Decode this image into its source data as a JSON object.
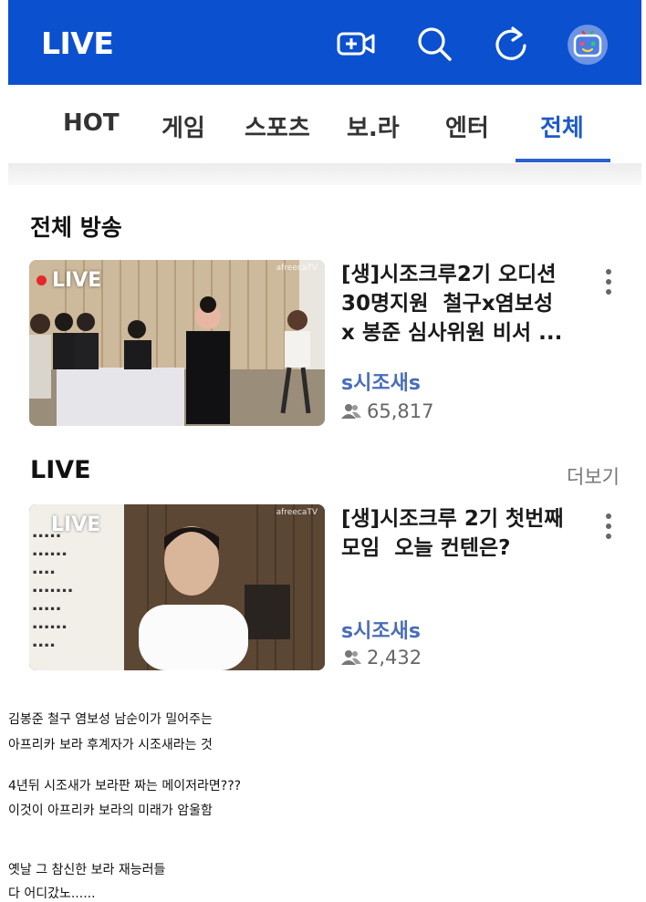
{
  "header": {
    "logo": "LIVE",
    "icons": [
      "video-add-icon",
      "search-icon",
      "refresh-icon",
      "profile-tv-icon"
    ],
    "brand_color": "#0b50cf"
  },
  "tabs": [
    {
      "label": "HOT",
      "active": false
    },
    {
      "label": "게임",
      "active": false
    },
    {
      "label": "스포츠",
      "active": false
    },
    {
      "label": "보.라",
      "active": false
    },
    {
      "label": "엔터",
      "active": false
    },
    {
      "label": "전체",
      "active": true
    }
  ],
  "sections": {
    "all_title": "전체 방송",
    "live_title": "LIVE",
    "more_label": "더보기"
  },
  "broadcasts": [
    {
      "badge": "LIVE",
      "watermark": "afreecaTV",
      "title": "[생]시조크루2기 오디션\n30명지원  철구x염보성\nx 봉준 심사위원 비서 ...",
      "channel": "s시조새s",
      "viewers": "65,817"
    },
    {
      "badge": "LIVE",
      "watermark": "afreecaTV",
      "title": "[생]시조크루 2기 첫번째\n모임  오늘 컨텐은?",
      "channel": "s시조새s",
      "viewers": "2,432"
    }
  ],
  "post_text": [
    "김봉준 철구 염보성 남순이가 밀어주는",
    "아프리카 보라 후계자가 시조새라는 것",
    "4년뒤 시조새가 보라판 짜는 메이저라면???",
    "이것이 아프리카 보라의 미래가 암울함",
    "옛날 그 참신한 보라 재능러들",
    "다 어디갔노......"
  ]
}
